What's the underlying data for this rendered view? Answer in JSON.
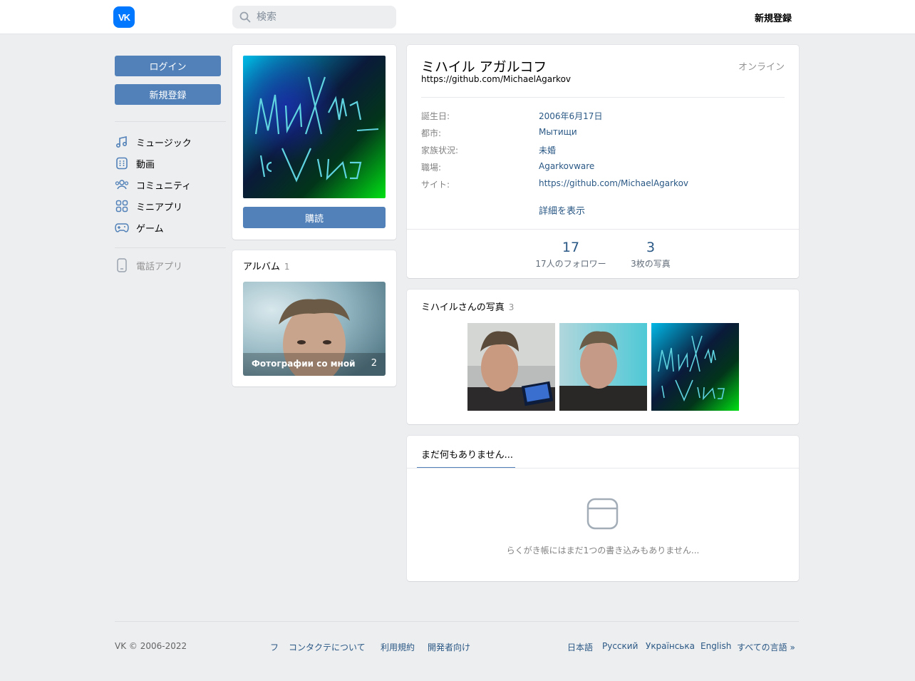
{
  "header": {
    "logo": "VK",
    "search_placeholder": "検索",
    "register_label": "新規登録"
  },
  "sidebar": {
    "login_label": "ログイン",
    "register_label": "新規登録",
    "items": [
      {
        "label": "ミュージック",
        "icon": "music-note-icon"
      },
      {
        "label": "動画",
        "icon": "video-icon"
      },
      {
        "label": "コミュニティ",
        "icon": "users-icon"
      },
      {
        "label": "ミニアプリ",
        "icon": "apps-icon"
      },
      {
        "label": "ゲーム",
        "icon": "gamepad-icon"
      }
    ],
    "phone_app_label": "電話アプリ"
  },
  "profile": {
    "subscribe_label": "購読",
    "albums_title": "アルバム",
    "albums_count": "1",
    "album": {
      "label": "Фотографии со мной",
      "count": "2"
    },
    "name": "ミハイル アガルコフ",
    "status": "https://github.com/MichaelAgarkov",
    "online": "オンライン",
    "info": [
      {
        "label": "誕生日:",
        "value": "2006年6月17日"
      },
      {
        "label": "都市:",
        "value": "Мытищи"
      },
      {
        "label": "家族状況:",
        "value": "未婚"
      },
      {
        "label": "職場:",
        "value": "Agarkovware"
      },
      {
        "label": "サイト:",
        "value": "https://github.com/MichaelAgarkov"
      }
    ],
    "more_label": "詳細を表示",
    "stats": [
      {
        "num": "17",
        "label": "17人のフォロワー"
      },
      {
        "num": "3",
        "label": "3枚の写真"
      }
    ],
    "photos_title": "ミハイルさんの写真",
    "photos_count": "3",
    "wall_tab": "まだ何もありません...",
    "wall_empty": "らくがき帳にはまだ1つの書き込みもありません..."
  },
  "footer": {
    "copyright": "VK © 2006-2022",
    "links": [
      "フ",
      "コンタクテについて",
      "利用規約",
      "開発者向け"
    ],
    "languages": [
      "日本語",
      "Русский",
      "Українська",
      "English",
      "すべての言語 »"
    ]
  },
  "colors": {
    "accent": "#5181b8",
    "link": "#2a5885",
    "background": "#edeef0",
    "logo": "#0077ff"
  }
}
